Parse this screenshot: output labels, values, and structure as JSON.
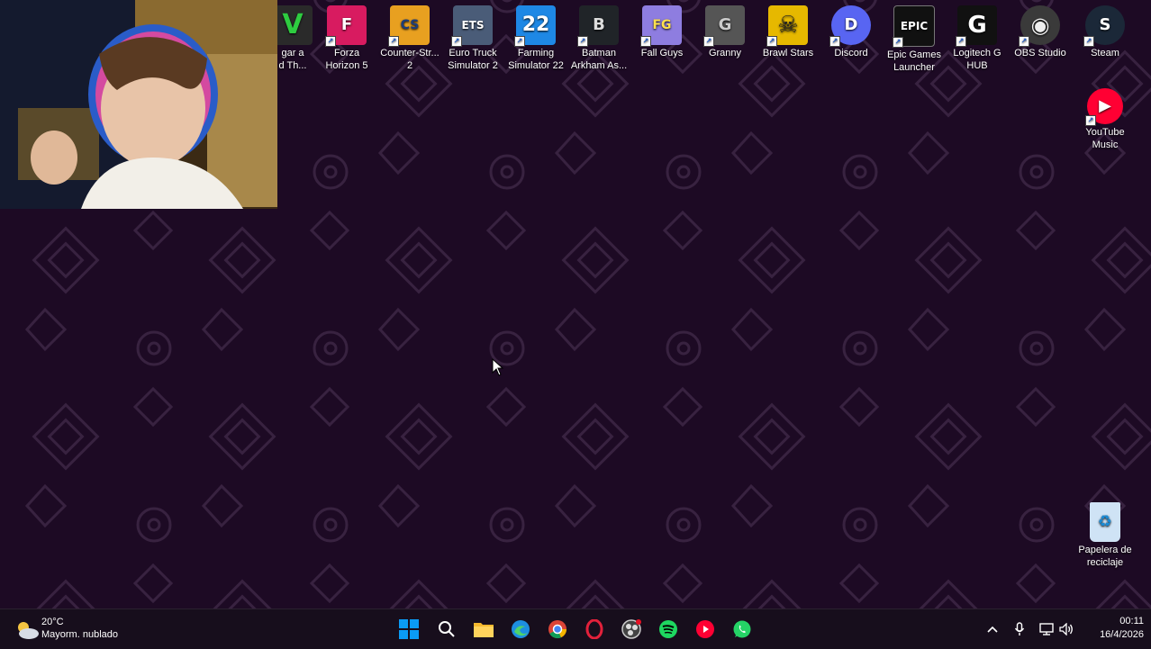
{
  "desktop_icons": [
    {
      "label": "gar a\nd Th...",
      "icon": "gta-v-icon",
      "color": "#2a2a2a"
    },
    {
      "label": "Forza\nHorizon 5",
      "icon": "forza-icon",
      "color": "#d81b60"
    },
    {
      "label": "Counter-Str...\n2",
      "icon": "counter-strike-icon",
      "color": "#e8a020"
    },
    {
      "label": "Euro Truck\nSimulator 2",
      "icon": "truck-icon",
      "color": "#4a5c78"
    },
    {
      "label": "Farming\nSimulator 22",
      "icon": "farming-icon",
      "color": "#1e88e5"
    },
    {
      "label": "Batman\nArkham As...",
      "icon": "batman-icon",
      "color": "#202428"
    },
    {
      "label": "Fall Guys",
      "icon": "fall-guys-icon",
      "color": "#8e7de0"
    },
    {
      "label": "Granny",
      "icon": "granny-icon",
      "color": "#555555"
    },
    {
      "label": "Brawl Stars",
      "icon": "brawl-stars-icon",
      "color": "#e6b800"
    },
    {
      "label": "Discord",
      "icon": "discord-icon",
      "color": "#5865f2"
    },
    {
      "label": "Epic Games\nLauncher",
      "icon": "epic-games-icon",
      "color": "#111111"
    },
    {
      "label": "Logitech G\nHUB",
      "icon": "logitech-icon",
      "color": "#111111"
    },
    {
      "label": "OBS Studio",
      "icon": "obs-icon",
      "color": "#3a3a3a"
    },
    {
      "label": "Steam",
      "icon": "steam-icon",
      "color": "#1b2838"
    },
    {
      "label": "YouTube\nMusic",
      "icon": "youtube-music-icon",
      "color": "#ff0033"
    },
    {
      "label": "Papelera de\nreciclaje",
      "icon": "recycle-bin-icon",
      "color": "#cfe3f5"
    }
  ],
  "tile_glyphs": {
    "gta": "V",
    "forza": "F",
    "cs": "CS",
    "ets": "ETS",
    "fs": "22",
    "batman": "B",
    "fallguys": "FG",
    "granny": "G",
    "brawl": "☠",
    "discord": "D",
    "epic": "EPIC",
    "logi": "G",
    "obs": "◉",
    "steam": "S",
    "ytmusic": "▶",
    "recycle": "♻"
  },
  "weather": {
    "temp": "20°C",
    "desc": "Mayorm. nublado"
  },
  "clock": {
    "time": "00:11",
    "date": "16/4/2026"
  },
  "colors": {
    "wallpaper": "#1d0a24",
    "taskbar": "#170e1c",
    "accent": "#0078d4"
  }
}
